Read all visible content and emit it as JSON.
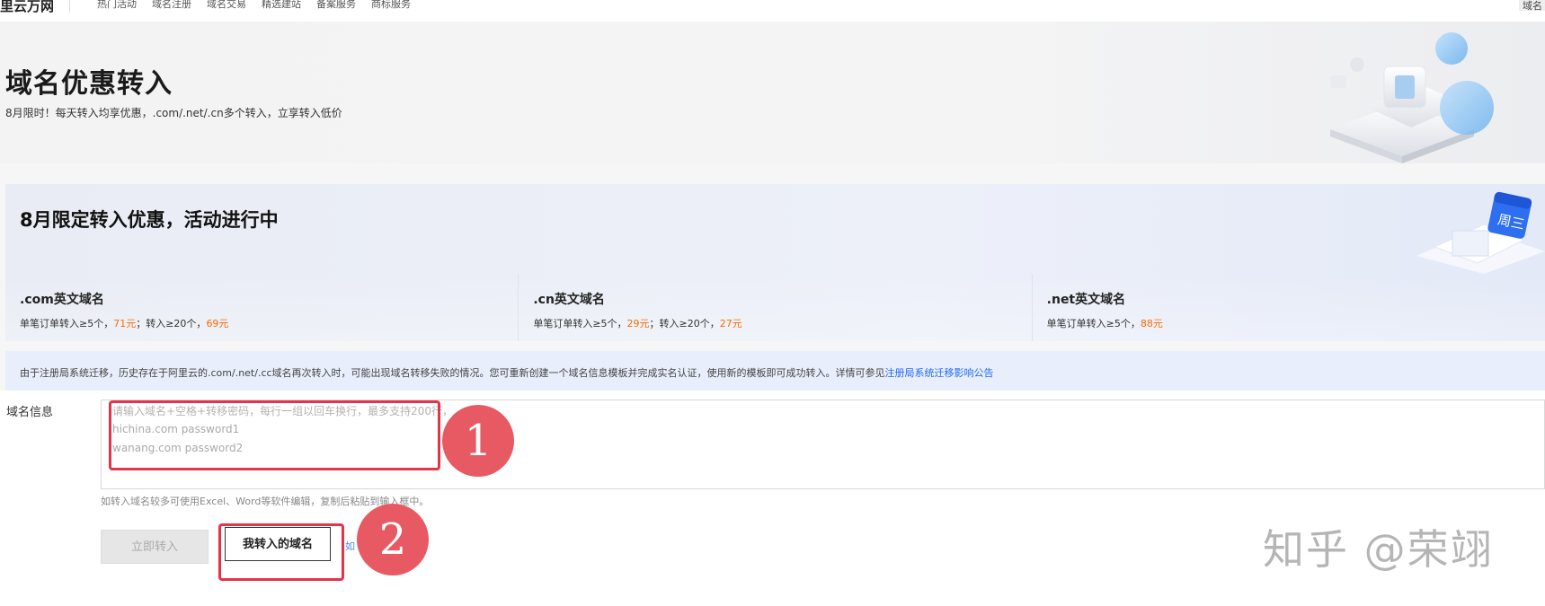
{
  "topnav": {
    "brand": "里云万网",
    "items": [
      "热门活动",
      "域名注册",
      "域名交易",
      "精选建站",
      "备案服务",
      "商标服务"
    ],
    "right_text": "域名"
  },
  "hero": {
    "title": "域名优惠转入",
    "subtitle": "8月限时！每天转入均享优惠，.com/.net/.cn多个转入，立享转入低价"
  },
  "promo": {
    "title": "8月限定转入优惠，活动进行中",
    "cards": [
      {
        "title": ".com英文域名",
        "desc_prefix": "单笔订单转入≥5个，",
        "price1": "71元",
        "desc_mid": "；转入≥20个，",
        "price2": "69元"
      },
      {
        "title": ".cn英文域名",
        "desc_prefix": "单笔订单转入≥5个，",
        "price1": "29元",
        "desc_mid": "；转入≥20个，",
        "price2": "27元"
      },
      {
        "title": ".net英文域名",
        "desc_prefix": "单笔订单转入≥5个，",
        "price1": "88元",
        "desc_mid": "",
        "price2": ""
      }
    ]
  },
  "notice": {
    "text": "由于注册局系统迁移，历史存在于阿里云的.com/.net/.cc域名再次转入时，可能出现域名转移失败的情况。您可重新创建一个域名信息模板并完成实名认证，使用新的模板即可成功转入。详情可参见",
    "link": "注册局系统迁移影响公告"
  },
  "form": {
    "label": "域名信息",
    "placeholder_lines": [
      "请输入域名+空格+转移密码，每行一组以回车换行，最多支持200行，",
      "hichina.com password1",
      "wanang.com password2"
    ],
    "hint": "如转入域名较多可使用Excel、Word等软件编辑，复制后粘贴到输入框中。",
    "submit_label": "立即转入",
    "my_transfers_label": "我转入的域名",
    "partial_link": "如"
  },
  "annotations": {
    "badge1": "1",
    "badge2": "2"
  },
  "watermark": "知乎 @荣翊",
  "colors": {
    "price": "#ff6a00",
    "link": "#1f6cf0",
    "highlight": "#e5334a",
    "badge": "#e85a63"
  }
}
